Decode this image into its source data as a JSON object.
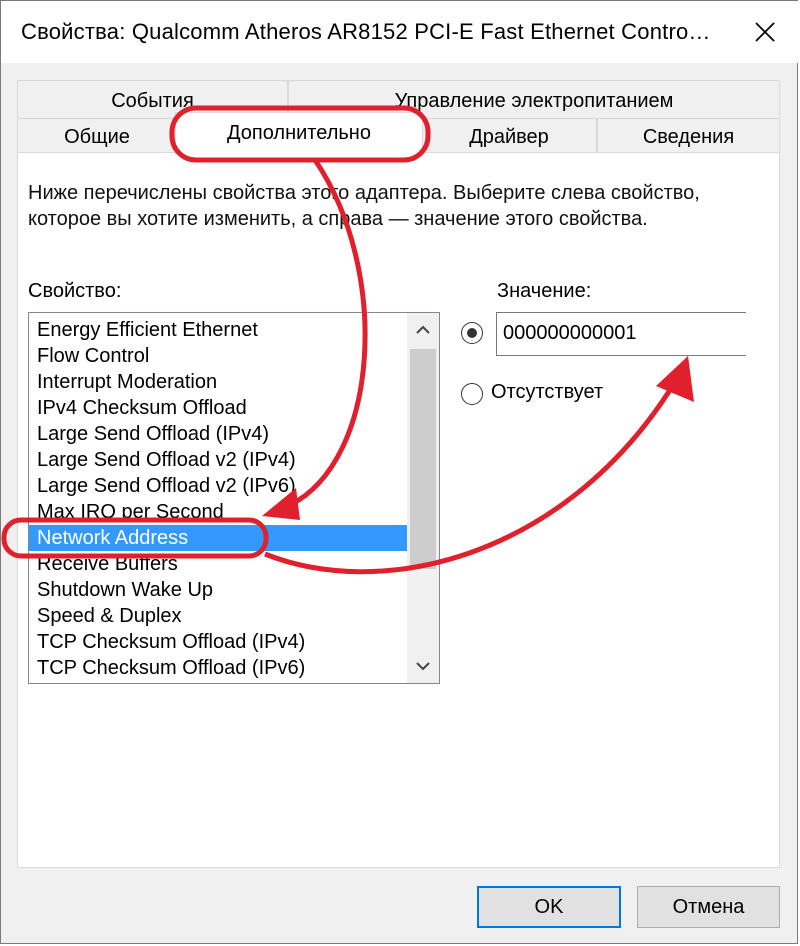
{
  "window": {
    "title": "Свойства: Qualcomm Atheros AR8152 PCI-E Fast Ethernet Contro…",
    "close_glyph": "✕"
  },
  "tabs": {
    "row_back": [
      {
        "label": "События"
      },
      {
        "label": "Управление электропитанием"
      }
    ],
    "row_front": [
      {
        "label": "Общие"
      },
      {
        "label": "Дополнительно",
        "active": true
      },
      {
        "label": "Драйвер"
      },
      {
        "label": "Сведения"
      }
    ]
  },
  "advanced": {
    "description": "Ниже перечислены свойства этого адаптера. Выберите слева свойство, которое вы хотите изменить, а справа — значение этого свойства.",
    "property_label": "Свойство:",
    "value_label": "Значение:",
    "properties": [
      "Energy Efficient Ethernet",
      "Flow Control",
      "Interrupt Moderation",
      "IPv4 Checksum Offload",
      "Large Send Offload (IPv4)",
      "Large Send Offload v2 (IPv4)",
      "Large Send Offload v2 (IPv6)",
      "Max IRQ per Second",
      "Network Address",
      "Receive Buffers",
      "Shutdown Wake Up",
      "Speed & Duplex",
      "TCP Checksum Offload (IPv4)",
      "TCP Checksum Offload (IPv6)"
    ],
    "selected_property": "Network Address",
    "value_option": {
      "value": "000000000001",
      "selected": true
    },
    "absent_option": {
      "label": "Отсутствует",
      "selected": false
    }
  },
  "buttons": {
    "ok_label": "OK",
    "cancel_label": "Отмена"
  },
  "colors": {
    "selection": "#3399ff",
    "annotation": "#e0202c",
    "default_button_border": "#0078d7"
  },
  "icons": {
    "close": "close-icon",
    "scroll_up": "chevron-up-icon",
    "scroll_down": "chevron-down-icon"
  }
}
